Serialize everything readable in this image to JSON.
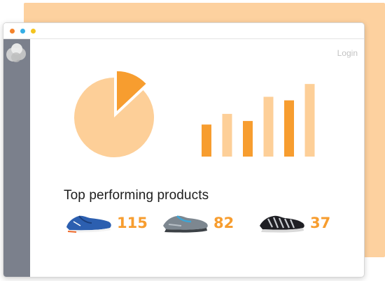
{
  "window": {
    "traffic_lights": [
      {
        "name": "close",
        "color": "#f4822a"
      },
      {
        "name": "minimize",
        "color": "#35aee6"
      },
      {
        "name": "maximize",
        "color": "#f3c41f"
      }
    ]
  },
  "header": {
    "login_label": "Login"
  },
  "colors": {
    "accent": "#f79d2f",
    "accent_light": "#fdcf98",
    "sidebar": "#7b808c"
  },
  "chart_data": [
    {
      "type": "pie",
      "slices": [
        {
          "value": 87,
          "color": "#fdcf98",
          "exploded": false
        },
        {
          "value": 13,
          "color": "#f79d2f",
          "exploded": true
        }
      ]
    },
    {
      "type": "bar",
      "values": [
        45,
        60,
        50,
        84,
        79,
        102
      ],
      "colors": [
        "#f79d2f",
        "#fdcf98",
        "#f79d2f",
        "#fdcf98",
        "#f79d2f",
        "#fdcf98"
      ],
      "ylim": [
        0,
        110
      ]
    }
  ],
  "main": {
    "section_title": "Top performing products",
    "products": [
      {
        "icon": "blue-running-shoe-icon",
        "count": "115"
      },
      {
        "icon": "grey-running-shoe-icon",
        "count": "82"
      },
      {
        "icon": "black-running-shoe-icon",
        "count": "37"
      }
    ]
  }
}
